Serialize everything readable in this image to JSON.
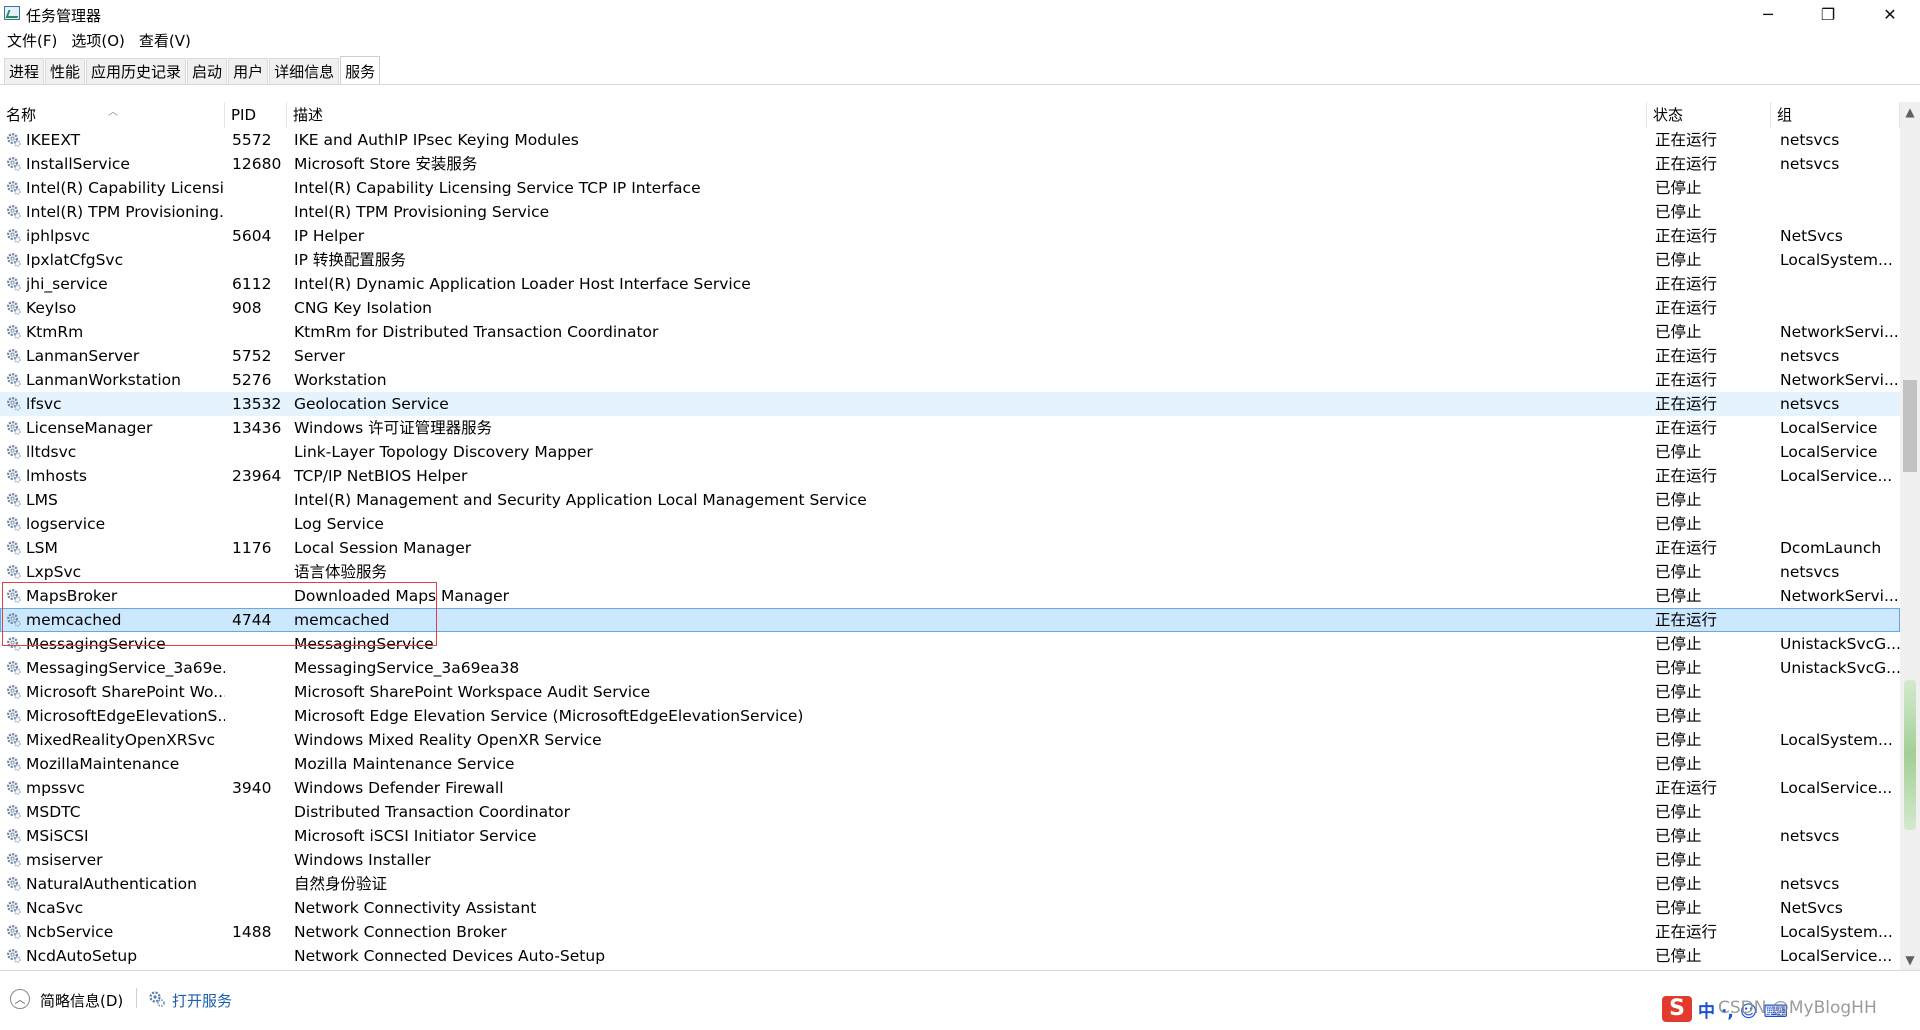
{
  "window": {
    "title": "任务管理器",
    "minimize": "─",
    "maximize": "❐",
    "close": "✕"
  },
  "menu": [
    "文件(F)",
    "选项(O)",
    "查看(V)"
  ],
  "tabs": [
    "进程",
    "性能",
    "应用历史记录",
    "启动",
    "用户",
    "详细信息",
    "服务"
  ],
  "active_tab": "服务",
  "columns": {
    "name": "名称",
    "pid": "PID",
    "desc": "描述",
    "status": "状态",
    "group": "组"
  },
  "rows": [
    {
      "name": "IKEEXT",
      "pid": "5572",
      "desc": "IKE and AuthIP IPsec Keying Modules",
      "status": "正在运行",
      "group": "netsvcs"
    },
    {
      "name": "InstallService",
      "pid": "12680",
      "desc": "Microsoft Store 安装服务",
      "status": "正在运行",
      "group": "netsvcs"
    },
    {
      "name": "Intel(R) Capability Licensi...",
      "pid": "",
      "desc": "Intel(R) Capability Licensing Service TCP IP Interface",
      "status": "已停止",
      "group": ""
    },
    {
      "name": "Intel(R) TPM Provisioning...",
      "pid": "",
      "desc": "Intel(R) TPM Provisioning Service",
      "status": "已停止",
      "group": ""
    },
    {
      "name": "iphlpsvc",
      "pid": "5604",
      "desc": "IP Helper",
      "status": "正在运行",
      "group": "NetSvcs"
    },
    {
      "name": "IpxlatCfgSvc",
      "pid": "",
      "desc": "IP 转换配置服务",
      "status": "已停止",
      "group": "LocalSystem..."
    },
    {
      "name": "jhi_service",
      "pid": "6112",
      "desc": "Intel(R) Dynamic Application Loader Host Interface Service",
      "status": "正在运行",
      "group": ""
    },
    {
      "name": "KeyIso",
      "pid": "908",
      "desc": "CNG Key Isolation",
      "status": "正在运行",
      "group": ""
    },
    {
      "name": "KtmRm",
      "pid": "",
      "desc": "KtmRm for Distributed Transaction Coordinator",
      "status": "已停止",
      "group": "NetworkServi..."
    },
    {
      "name": "LanmanServer",
      "pid": "5752",
      "desc": "Server",
      "status": "正在运行",
      "group": "netsvcs"
    },
    {
      "name": "LanmanWorkstation",
      "pid": "5276",
      "desc": "Workstation",
      "status": "正在运行",
      "group": "NetworkServi..."
    },
    {
      "name": "lfsvc",
      "pid": "13532",
      "desc": "Geolocation Service",
      "status": "正在运行",
      "group": "netsvcs"
    },
    {
      "name": "LicenseManager",
      "pid": "13436",
      "desc": "Windows 许可证管理器服务",
      "status": "正在运行",
      "group": "LocalService"
    },
    {
      "name": "lltdsvc",
      "pid": "",
      "desc": "Link-Layer Topology Discovery Mapper",
      "status": "已停止",
      "group": "LocalService"
    },
    {
      "name": "lmhosts",
      "pid": "23964",
      "desc": "TCP/IP NetBIOS Helper",
      "status": "正在运行",
      "group": "LocalService..."
    },
    {
      "name": "LMS",
      "pid": "",
      "desc": "Intel(R) Management and Security Application Local Management Service",
      "status": "已停止",
      "group": ""
    },
    {
      "name": "logservice",
      "pid": "",
      "desc": "Log Service",
      "status": "已停止",
      "group": ""
    },
    {
      "name": "LSM",
      "pid": "1176",
      "desc": "Local Session Manager",
      "status": "正在运行",
      "group": "DcomLaunch"
    },
    {
      "name": "LxpSvc",
      "pid": "",
      "desc": "语言体验服务",
      "status": "已停止",
      "group": "netsvcs"
    },
    {
      "name": "MapsBroker",
      "pid": "",
      "desc": "Downloaded Maps Manager",
      "status": "已停止",
      "group": "NetworkServi..."
    },
    {
      "name": "memcached",
      "pid": "4744",
      "desc": "memcached",
      "status": "正在运行",
      "group": ""
    },
    {
      "name": "MessagingService",
      "pid": "",
      "desc": "MessagingService",
      "status": "已停止",
      "group": "UnistackSvcG..."
    },
    {
      "name": "MessagingService_3a69e...",
      "pid": "",
      "desc": "MessagingService_3a69ea38",
      "status": "已停止",
      "group": "UnistackSvcG..."
    },
    {
      "name": "Microsoft SharePoint Wo...",
      "pid": "",
      "desc": "Microsoft SharePoint Workspace Audit Service",
      "status": "已停止",
      "group": ""
    },
    {
      "name": "MicrosoftEdgeElevationS...",
      "pid": "",
      "desc": "Microsoft Edge Elevation Service (MicrosoftEdgeElevationService)",
      "status": "已停止",
      "group": ""
    },
    {
      "name": "MixedRealityOpenXRSvc",
      "pid": "",
      "desc": "Windows Mixed Reality OpenXR Service",
      "status": "已停止",
      "group": "LocalSystem..."
    },
    {
      "name": "MozillaMaintenance",
      "pid": "",
      "desc": "Mozilla Maintenance Service",
      "status": "已停止",
      "group": ""
    },
    {
      "name": "mpssvc",
      "pid": "3940",
      "desc": "Windows Defender Firewall",
      "status": "正在运行",
      "group": "LocalService..."
    },
    {
      "name": "MSDTC",
      "pid": "",
      "desc": "Distributed Transaction Coordinator",
      "status": "已停止",
      "group": ""
    },
    {
      "name": "MSiSCSI",
      "pid": "",
      "desc": "Microsoft iSCSI Initiator Service",
      "status": "已停止",
      "group": "netsvcs"
    },
    {
      "name": "msiserver",
      "pid": "",
      "desc": "Windows Installer",
      "status": "已停止",
      "group": ""
    },
    {
      "name": "NaturalAuthentication",
      "pid": "",
      "desc": "自然身份验证",
      "status": "已停止",
      "group": "netsvcs"
    },
    {
      "name": "NcaSvc",
      "pid": "",
      "desc": "Network Connectivity Assistant",
      "status": "已停止",
      "group": "NetSvcs"
    },
    {
      "name": "NcbService",
      "pid": "1488",
      "desc": "Network Connection Broker",
      "status": "正在运行",
      "group": "LocalSystem..."
    },
    {
      "name": "NcdAutoSetup",
      "pid": "",
      "desc": "Network Connected Devices Auto-Setup",
      "status": "已停止",
      "group": "LocalService..."
    }
  ],
  "hover_row": "lfsvc",
  "selected_row": "memcached",
  "footer": {
    "fewer_details": "简略信息(D)",
    "open_services": "打开服务"
  },
  "tray": {
    "ime_logo": "S",
    "ime_text": "中 ·, ☺ ⌨",
    "watermark": "CSDN @MyBlogHH"
  },
  "colors": {
    "hover": "#e5f3ff",
    "selected": "#cce8ff",
    "annotation": "#e04040",
    "link": "#1a5fb4"
  },
  "icons": {
    "service": "gear-icon",
    "sort": "sort-ascending-icon"
  }
}
